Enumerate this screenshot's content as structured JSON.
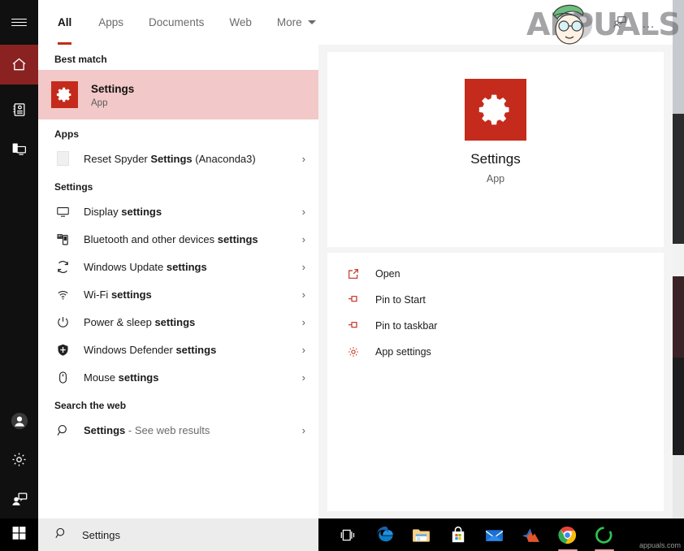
{
  "window": {
    "title": "Windows Search",
    "accent_red": "#c42b1c",
    "highlight_pink": "#f3c8c8",
    "rail_bg": "#101010",
    "preview_bg": "#f4f4f4"
  },
  "rail": {
    "hamburger": "hamburger-menu",
    "items": [
      {
        "name": "home",
        "label": "Home",
        "active": true
      },
      {
        "name": "notebook",
        "label": "Notebook",
        "active": false
      },
      {
        "name": "devices",
        "label": "Devices",
        "active": false
      },
      {
        "name": "account",
        "label": "Account",
        "active": false
      },
      {
        "name": "settings",
        "label": "Settings",
        "active": false
      },
      {
        "name": "feedback",
        "label": "Feedback",
        "active": false
      }
    ]
  },
  "header": {
    "tabs": [
      {
        "label": "All",
        "active": true
      },
      {
        "label": "Apps",
        "active": false
      },
      {
        "label": "Documents",
        "active": false
      },
      {
        "label": "Web",
        "active": false
      },
      {
        "label": "More",
        "active": false,
        "has_caret": true
      }
    ],
    "right_icons": [
      "feedback-icon",
      "more-options-icon"
    ],
    "more_options": "…"
  },
  "watermark": {
    "text": "APPUALS",
    "site": "appuals.com"
  },
  "results": {
    "best_match_header": "Best match",
    "best_match": {
      "title": "Settings",
      "subtitle": "App",
      "icon": "settings-gear-icon"
    },
    "apps_header": "Apps",
    "apps": [
      {
        "prefix": "Reset Spyder ",
        "bold": "Settings",
        "suffix": " (Anaconda3)",
        "icon": "document-icon"
      }
    ],
    "settings_header": "Settings",
    "settings": [
      {
        "prefix": "Display ",
        "bold": "settings",
        "suffix": "",
        "icon": "monitor-icon"
      },
      {
        "prefix": "Bluetooth and other devices ",
        "bold": "settings",
        "suffix": "",
        "icon": "bluetooth-devices-icon"
      },
      {
        "prefix": "Windows Update ",
        "bold": "settings",
        "suffix": "",
        "icon": "refresh-icon"
      },
      {
        "prefix": "Wi-Fi ",
        "bold": "settings",
        "suffix": "",
        "icon": "wifi-icon"
      },
      {
        "prefix": "Power & sleep ",
        "bold": "settings",
        "suffix": "",
        "icon": "power-icon"
      },
      {
        "prefix": "Windows Defender ",
        "bold": "settings",
        "suffix": "",
        "icon": "shield-icon"
      },
      {
        "prefix": "Mouse ",
        "bold": "settings",
        "suffix": "",
        "icon": "mouse-icon"
      }
    ],
    "web_header": "Search the web",
    "web": [
      {
        "prefix": "",
        "bold": "Settings",
        "suffix": " - See web results",
        "icon": "search-icon"
      }
    ],
    "chevron": "›"
  },
  "preview": {
    "app_name": "Settings",
    "app_type": "App",
    "icon": "settings-gear-icon",
    "actions": [
      {
        "label": "Open",
        "icon": "open-external-icon"
      },
      {
        "label": "Pin to Start",
        "icon": "pin-icon"
      },
      {
        "label": "Pin to taskbar",
        "icon": "pin-icon"
      },
      {
        "label": "App settings",
        "icon": "gear-icon"
      }
    ]
  },
  "taskbar": {
    "start": "windows-start-icon",
    "search_value": "Settings",
    "search_icon": "search-icon",
    "apps": [
      {
        "name": "task-view",
        "label": "Task View"
      },
      {
        "name": "microsoft-edge",
        "label": "Microsoft Edge"
      },
      {
        "name": "file-explorer",
        "label": "File Explorer"
      },
      {
        "name": "microsoft-store",
        "label": "Microsoft Store"
      },
      {
        "name": "mail",
        "label": "Mail"
      },
      {
        "name": "matlab",
        "label": "MATLAB"
      },
      {
        "name": "google-chrome",
        "label": "Google Chrome"
      },
      {
        "name": "green-ring-app",
        "label": "App"
      }
    ],
    "watermark": "appuals.com"
  }
}
